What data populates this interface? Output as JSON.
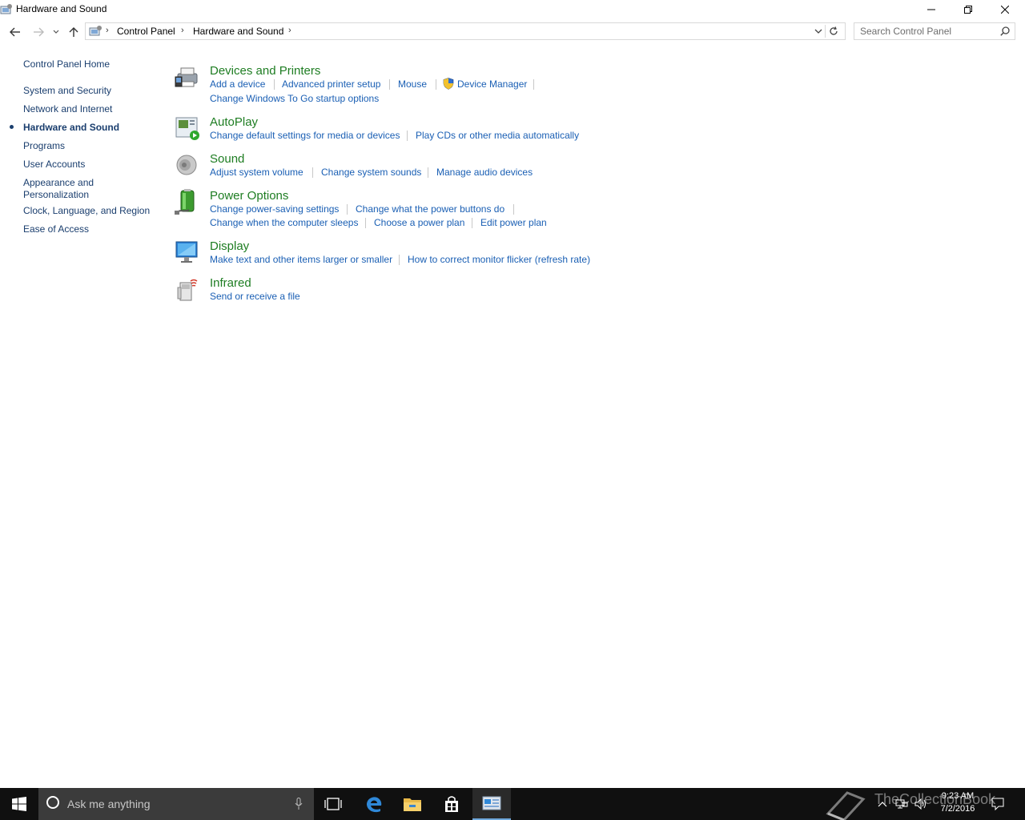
{
  "window": {
    "title": "Hardware and Sound",
    "icon": "control-panel-icon",
    "controls": [
      "minimize",
      "restore",
      "close"
    ]
  },
  "address_bar": {
    "location_icon": "control-panel-icon",
    "breadcrumbs": [
      "Control Panel",
      "Hardware and Sound"
    ]
  },
  "search": {
    "placeholder": "Search Control Panel",
    "value": ""
  },
  "left_nav": {
    "home": "Control Panel Home",
    "items": [
      {
        "label": "System and Security",
        "active": false
      },
      {
        "label": "Network and Internet",
        "active": false
      },
      {
        "label": "Hardware and Sound",
        "active": true
      },
      {
        "label": "Programs",
        "active": false
      },
      {
        "label": "User Accounts",
        "active": false
      },
      {
        "label": "Appearance and",
        "label2": "Personalization",
        "active": false
      },
      {
        "label": "Clock, Language, and Region",
        "active": false
      },
      {
        "label": "Ease of Access",
        "active": false
      }
    ]
  },
  "categories": [
    {
      "title": "Devices and Printers",
      "icon": "printer-icon",
      "links": [
        "Add a device",
        "Advanced printer setup",
        "Mouse",
        "Device Manager",
        "Change Windows To Go startup options"
      ],
      "shield_link": "Device Manager"
    },
    {
      "title": "AutoPlay",
      "icon": "autoplay-icon",
      "links": [
        "Change default settings for media or devices",
        "Play CDs or other media automatically"
      ]
    },
    {
      "title": "Sound",
      "icon": "speaker-icon",
      "links": [
        "Adjust system volume",
        "Change system sounds",
        "Manage audio devices"
      ]
    },
    {
      "title": "Power Options",
      "icon": "battery-icon",
      "links": [
        "Change power-saving settings",
        "Change what the power buttons do",
        "Change when the computer sleeps",
        "Choose a power plan",
        "Edit power plan"
      ]
    },
    {
      "title": "Display",
      "icon": "monitor-icon",
      "links": [
        "Make text and other items larger or smaller",
        "How to correct monitor flicker (refresh rate)"
      ]
    },
    {
      "title": "Infrared",
      "icon": "infrared-icon",
      "links": [
        "Send or receive a file"
      ]
    }
  ],
  "taskbar": {
    "cortana_placeholder": "Ask me anything",
    "apps": [
      "task-view-icon",
      "edge-icon",
      "file-explorer-icon",
      "store-icon",
      "control-panel-icon"
    ],
    "clock": {
      "time": "9:23 AM",
      "date": "7/2/2016"
    },
    "watermark": "TheCollectionBook"
  },
  "colors": {
    "link": "#1a5fb4",
    "category_title": "#1e7d22",
    "taskbar": "#101010"
  }
}
